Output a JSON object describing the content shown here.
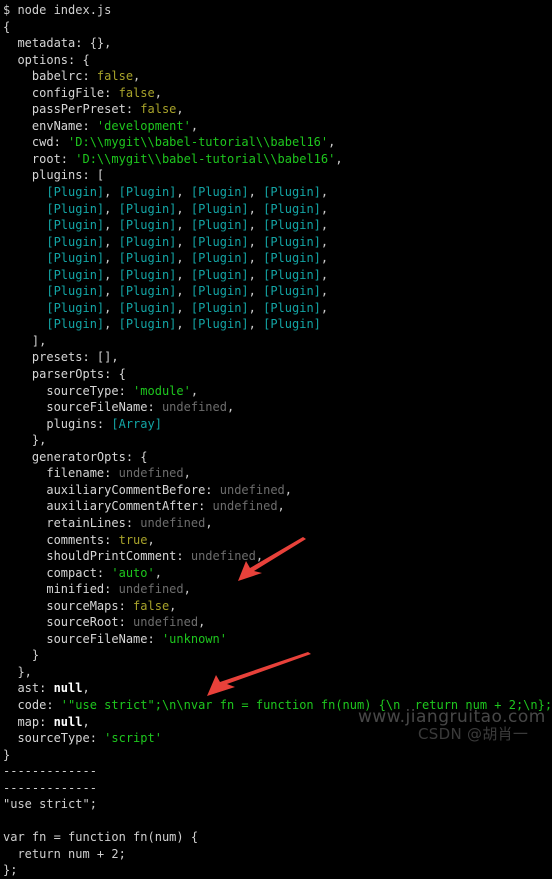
{
  "terminal": {
    "prompt": "$ ",
    "command": "node index.js",
    "colors": {
      "background": "#000000",
      "default_text": "#cfcfcf",
      "string": "#1ec71e",
      "boolean": "#a8a32a",
      "undefined": "#6d6d6d",
      "reference": "#13a5a5",
      "null": "#ffffff",
      "arrow": "#e8413a",
      "watermark": "#ebebeb"
    }
  },
  "lines": [
    {
      "id": "prompt-line",
      "segments": [
        {
          "t": "$ node index.js",
          "c": "tok-prompt"
        }
      ]
    },
    {
      "id": "obj-open",
      "segments": [
        {
          "t": "{",
          "c": "tok-punct"
        }
      ]
    },
    {
      "id": "metadata",
      "segments": [
        {
          "t": "  metadata: ",
          "c": "tok-key"
        },
        {
          "t": "{},",
          "c": "tok-punct"
        }
      ]
    },
    {
      "id": "options-open",
      "segments": [
        {
          "t": "  options: {",
          "c": "tok-key"
        }
      ]
    },
    {
      "id": "babelrc",
      "segments": [
        {
          "t": "    babelrc: ",
          "c": "tok-key"
        },
        {
          "t": "false",
          "c": "tok-bool"
        },
        {
          "t": ",",
          "c": "tok-punct"
        }
      ]
    },
    {
      "id": "configFile",
      "segments": [
        {
          "t": "    configFile: ",
          "c": "tok-key"
        },
        {
          "t": "false",
          "c": "tok-bool"
        },
        {
          "t": ",",
          "c": "tok-punct"
        }
      ]
    },
    {
      "id": "passPerPreset",
      "segments": [
        {
          "t": "    passPerPreset: ",
          "c": "tok-key"
        },
        {
          "t": "false",
          "c": "tok-bool"
        },
        {
          "t": ",",
          "c": "tok-punct"
        }
      ]
    },
    {
      "id": "envName",
      "segments": [
        {
          "t": "    envName: ",
          "c": "tok-key"
        },
        {
          "t": "'development'",
          "c": "tok-str"
        },
        {
          "t": ",",
          "c": "tok-punct"
        }
      ]
    },
    {
      "id": "cwd",
      "segments": [
        {
          "t": "    cwd: ",
          "c": "tok-key"
        },
        {
          "t": "'D:\\\\mygit\\\\babel-tutorial\\\\babel16'",
          "c": "tok-str"
        },
        {
          "t": ",",
          "c": "tok-punct"
        }
      ]
    },
    {
      "id": "root",
      "segments": [
        {
          "t": "    root: ",
          "c": "tok-key"
        },
        {
          "t": "'D:\\\\mygit\\\\babel-tutorial\\\\babel16'",
          "c": "tok-str"
        },
        {
          "t": ",",
          "c": "tok-punct"
        }
      ]
    },
    {
      "id": "plugins-open",
      "segments": [
        {
          "t": "    plugins: [",
          "c": "tok-key"
        }
      ]
    },
    {
      "id": "plugins-row-1",
      "segments": [
        {
          "t": "      ",
          "c": "tok-punct"
        },
        {
          "t": "[Plugin]",
          "c": "tok-cyan"
        },
        {
          "t": ", ",
          "c": "tok-punct"
        },
        {
          "t": "[Plugin]",
          "c": "tok-cyan"
        },
        {
          "t": ", ",
          "c": "tok-punct"
        },
        {
          "t": "[Plugin]",
          "c": "tok-cyan"
        },
        {
          "t": ", ",
          "c": "tok-punct"
        },
        {
          "t": "[Plugin]",
          "c": "tok-cyan"
        },
        {
          "t": ",",
          "c": "tok-punct"
        }
      ]
    },
    {
      "id": "plugins-row-2",
      "segments": [
        {
          "t": "      ",
          "c": "tok-punct"
        },
        {
          "t": "[Plugin]",
          "c": "tok-cyan"
        },
        {
          "t": ", ",
          "c": "tok-punct"
        },
        {
          "t": "[Plugin]",
          "c": "tok-cyan"
        },
        {
          "t": ", ",
          "c": "tok-punct"
        },
        {
          "t": "[Plugin]",
          "c": "tok-cyan"
        },
        {
          "t": ", ",
          "c": "tok-punct"
        },
        {
          "t": "[Plugin]",
          "c": "tok-cyan"
        },
        {
          "t": ",",
          "c": "tok-punct"
        }
      ]
    },
    {
      "id": "plugins-row-3",
      "segments": [
        {
          "t": "      ",
          "c": "tok-punct"
        },
        {
          "t": "[Plugin]",
          "c": "tok-cyan"
        },
        {
          "t": ", ",
          "c": "tok-punct"
        },
        {
          "t": "[Plugin]",
          "c": "tok-cyan"
        },
        {
          "t": ", ",
          "c": "tok-punct"
        },
        {
          "t": "[Plugin]",
          "c": "tok-cyan"
        },
        {
          "t": ", ",
          "c": "tok-punct"
        },
        {
          "t": "[Plugin]",
          "c": "tok-cyan"
        },
        {
          "t": ",",
          "c": "tok-punct"
        }
      ]
    },
    {
      "id": "plugins-row-4",
      "segments": [
        {
          "t": "      ",
          "c": "tok-punct"
        },
        {
          "t": "[Plugin]",
          "c": "tok-cyan"
        },
        {
          "t": ", ",
          "c": "tok-punct"
        },
        {
          "t": "[Plugin]",
          "c": "tok-cyan"
        },
        {
          "t": ", ",
          "c": "tok-punct"
        },
        {
          "t": "[Plugin]",
          "c": "tok-cyan"
        },
        {
          "t": ", ",
          "c": "tok-punct"
        },
        {
          "t": "[Plugin]",
          "c": "tok-cyan"
        },
        {
          "t": ",",
          "c": "tok-punct"
        }
      ]
    },
    {
      "id": "plugins-row-5",
      "segments": [
        {
          "t": "      ",
          "c": "tok-punct"
        },
        {
          "t": "[Plugin]",
          "c": "tok-cyan"
        },
        {
          "t": ", ",
          "c": "tok-punct"
        },
        {
          "t": "[Plugin]",
          "c": "tok-cyan"
        },
        {
          "t": ", ",
          "c": "tok-punct"
        },
        {
          "t": "[Plugin]",
          "c": "tok-cyan"
        },
        {
          "t": ", ",
          "c": "tok-punct"
        },
        {
          "t": "[Plugin]",
          "c": "tok-cyan"
        },
        {
          "t": ",",
          "c": "tok-punct"
        }
      ]
    },
    {
      "id": "plugins-row-6",
      "segments": [
        {
          "t": "      ",
          "c": "tok-punct"
        },
        {
          "t": "[Plugin]",
          "c": "tok-cyan"
        },
        {
          "t": ", ",
          "c": "tok-punct"
        },
        {
          "t": "[Plugin]",
          "c": "tok-cyan"
        },
        {
          "t": ", ",
          "c": "tok-punct"
        },
        {
          "t": "[Plugin]",
          "c": "tok-cyan"
        },
        {
          "t": ", ",
          "c": "tok-punct"
        },
        {
          "t": "[Plugin]",
          "c": "tok-cyan"
        },
        {
          "t": ",",
          "c": "tok-punct"
        }
      ]
    },
    {
      "id": "plugins-row-7",
      "segments": [
        {
          "t": "      ",
          "c": "tok-punct"
        },
        {
          "t": "[Plugin]",
          "c": "tok-cyan"
        },
        {
          "t": ", ",
          "c": "tok-punct"
        },
        {
          "t": "[Plugin]",
          "c": "tok-cyan"
        },
        {
          "t": ", ",
          "c": "tok-punct"
        },
        {
          "t": "[Plugin]",
          "c": "tok-cyan"
        },
        {
          "t": ", ",
          "c": "tok-punct"
        },
        {
          "t": "[Plugin]",
          "c": "tok-cyan"
        },
        {
          "t": ",",
          "c": "tok-punct"
        }
      ]
    },
    {
      "id": "plugins-row-8",
      "segments": [
        {
          "t": "      ",
          "c": "tok-punct"
        },
        {
          "t": "[Plugin]",
          "c": "tok-cyan"
        },
        {
          "t": ", ",
          "c": "tok-punct"
        },
        {
          "t": "[Plugin]",
          "c": "tok-cyan"
        },
        {
          "t": ", ",
          "c": "tok-punct"
        },
        {
          "t": "[Plugin]",
          "c": "tok-cyan"
        },
        {
          "t": ", ",
          "c": "tok-punct"
        },
        {
          "t": "[Plugin]",
          "c": "tok-cyan"
        },
        {
          "t": ",",
          "c": "tok-punct"
        }
      ]
    },
    {
      "id": "plugins-row-9",
      "segments": [
        {
          "t": "      ",
          "c": "tok-punct"
        },
        {
          "t": "[Plugin]",
          "c": "tok-cyan"
        },
        {
          "t": ", ",
          "c": "tok-punct"
        },
        {
          "t": "[Plugin]",
          "c": "tok-cyan"
        },
        {
          "t": ", ",
          "c": "tok-punct"
        },
        {
          "t": "[Plugin]",
          "c": "tok-cyan"
        },
        {
          "t": ", ",
          "c": "tok-punct"
        },
        {
          "t": "[Plugin]",
          "c": "tok-cyan"
        }
      ]
    },
    {
      "id": "plugins-close",
      "segments": [
        {
          "t": "    ],",
          "c": "tok-punct"
        }
      ]
    },
    {
      "id": "presets",
      "segments": [
        {
          "t": "    presets: ",
          "c": "tok-key"
        },
        {
          "t": "[],",
          "c": "tok-punct"
        }
      ]
    },
    {
      "id": "parserOpts-open",
      "segments": [
        {
          "t": "    parserOpts: {",
          "c": "tok-key"
        }
      ]
    },
    {
      "id": "sourceType-parser",
      "segments": [
        {
          "t": "      sourceType: ",
          "c": "tok-key"
        },
        {
          "t": "'module'",
          "c": "tok-str"
        },
        {
          "t": ",",
          "c": "tok-punct"
        }
      ]
    },
    {
      "id": "sourceFileName-parser",
      "segments": [
        {
          "t": "      sourceFileName: ",
          "c": "tok-key"
        },
        {
          "t": "undefined",
          "c": "tok-undef"
        },
        {
          "t": ",",
          "c": "tok-punct"
        }
      ]
    },
    {
      "id": "plugins-parser",
      "segments": [
        {
          "t": "      plugins: ",
          "c": "tok-key"
        },
        {
          "t": "[Array]",
          "c": "tok-cyan"
        }
      ]
    },
    {
      "id": "parserOpts-close",
      "segments": [
        {
          "t": "    },",
          "c": "tok-punct"
        }
      ]
    },
    {
      "id": "generatorOpts-open",
      "segments": [
        {
          "t": "    generatorOpts: {",
          "c": "tok-key"
        }
      ]
    },
    {
      "id": "filename",
      "segments": [
        {
          "t": "      filename: ",
          "c": "tok-key"
        },
        {
          "t": "undefined",
          "c": "tok-undef"
        },
        {
          "t": ",",
          "c": "tok-punct"
        }
      ]
    },
    {
      "id": "auxiliaryCommentBefore",
      "segments": [
        {
          "t": "      auxiliaryCommentBefore: ",
          "c": "tok-key"
        },
        {
          "t": "undefined",
          "c": "tok-undef"
        },
        {
          "t": ",",
          "c": "tok-punct"
        }
      ]
    },
    {
      "id": "auxiliaryCommentAfter",
      "segments": [
        {
          "t": "      auxiliaryCommentAfter: ",
          "c": "tok-key"
        },
        {
          "t": "undefined",
          "c": "tok-undef"
        },
        {
          "t": ",",
          "c": "tok-punct"
        }
      ]
    },
    {
      "id": "retainLines",
      "segments": [
        {
          "t": "      retainLines: ",
          "c": "tok-key"
        },
        {
          "t": "undefined",
          "c": "tok-undef"
        },
        {
          "t": ",",
          "c": "tok-punct"
        }
      ]
    },
    {
      "id": "comments",
      "segments": [
        {
          "t": "      comments: ",
          "c": "tok-key"
        },
        {
          "t": "true",
          "c": "tok-bool"
        },
        {
          "t": ",",
          "c": "tok-punct"
        }
      ]
    },
    {
      "id": "shouldPrintComment",
      "segments": [
        {
          "t": "      shouldPrintComment: ",
          "c": "tok-key"
        },
        {
          "t": "undefined",
          "c": "tok-undef"
        },
        {
          "t": ",",
          "c": "tok-punct"
        }
      ]
    },
    {
      "id": "compact",
      "segments": [
        {
          "t": "      compact: ",
          "c": "tok-key"
        },
        {
          "t": "'auto'",
          "c": "tok-str"
        },
        {
          "t": ",",
          "c": "tok-punct"
        }
      ]
    },
    {
      "id": "minified",
      "segments": [
        {
          "t": "      minified: ",
          "c": "tok-key"
        },
        {
          "t": "undefined",
          "c": "tok-undef"
        },
        {
          "t": ",",
          "c": "tok-punct"
        }
      ]
    },
    {
      "id": "sourceMaps",
      "segments": [
        {
          "t": "      sourceMaps: ",
          "c": "tok-key"
        },
        {
          "t": "false",
          "c": "tok-bool"
        },
        {
          "t": ",",
          "c": "tok-punct"
        }
      ]
    },
    {
      "id": "sourceRoot",
      "segments": [
        {
          "t": "      sourceRoot: ",
          "c": "tok-key"
        },
        {
          "t": "undefined",
          "c": "tok-undef"
        },
        {
          "t": ",",
          "c": "tok-punct"
        }
      ]
    },
    {
      "id": "sourceFileName-gen",
      "segments": [
        {
          "t": "      sourceFileName: ",
          "c": "tok-key"
        },
        {
          "t": "'unknown'",
          "c": "tok-str"
        }
      ]
    },
    {
      "id": "generatorOpts-close",
      "segments": [
        {
          "t": "    }",
          "c": "tok-punct"
        }
      ]
    },
    {
      "id": "options-close",
      "segments": [
        {
          "t": "  },",
          "c": "tok-punct"
        }
      ]
    },
    {
      "id": "ast",
      "segments": [
        {
          "t": "  ast: ",
          "c": "tok-key"
        },
        {
          "t": "null",
          "c": "tok-null"
        },
        {
          "t": ",",
          "c": "tok-punct"
        }
      ]
    },
    {
      "id": "code",
      "segments": [
        {
          "t": "  code: ",
          "c": "tok-key"
        },
        {
          "t": "'\"use strict\";\\n\\nvar fn = function fn(num) {\\n  return num + 2;\\n};'",
          "c": "tok-str"
        },
        {
          "t": ",",
          "c": "tok-punct"
        }
      ]
    },
    {
      "id": "map",
      "segments": [
        {
          "t": "  map: ",
          "c": "tok-key"
        },
        {
          "t": "null",
          "c": "tok-null"
        },
        {
          "t": ",",
          "c": "tok-punct"
        }
      ]
    },
    {
      "id": "sourceType-result",
      "segments": [
        {
          "t": "  sourceType: ",
          "c": "tok-key"
        },
        {
          "t": "'script'",
          "c": "tok-str"
        }
      ]
    },
    {
      "id": "obj-close",
      "segments": [
        {
          "t": "}",
          "c": "tok-punct"
        }
      ]
    },
    {
      "id": "separator-1",
      "segments": [
        {
          "t": "-------------",
          "c": "tok-dash"
        }
      ]
    },
    {
      "id": "separator-2",
      "segments": [
        {
          "t": "-------------",
          "c": "tok-dash"
        }
      ]
    },
    {
      "id": "output-use-strict",
      "segments": [
        {
          "t": "\"use strict\";",
          "c": "tok-plain"
        }
      ]
    },
    {
      "id": "output-blank",
      "segments": [
        {
          "t": " ",
          "c": "tok-plain"
        }
      ]
    },
    {
      "id": "output-fn-open",
      "segments": [
        {
          "t": "var fn = function fn(num) {",
          "c": "tok-plain"
        }
      ]
    },
    {
      "id": "output-fn-return",
      "segments": [
        {
          "t": "  return num + 2;",
          "c": "tok-plain"
        }
      ]
    },
    {
      "id": "output-fn-close",
      "segments": [
        {
          "t": "};",
          "c": "tok-plain"
        }
      ]
    }
  ],
  "annotations": {
    "arrows": [
      {
        "name": "arrow-pointing-at-code-value",
        "color": "#e8413a"
      },
      {
        "name": "arrow-pointing-at-output",
        "color": "#e8413a"
      }
    ]
  },
  "watermarks": {
    "site": "www.jiangruitao.com",
    "csdn": "CSDN @胡肖一"
  }
}
